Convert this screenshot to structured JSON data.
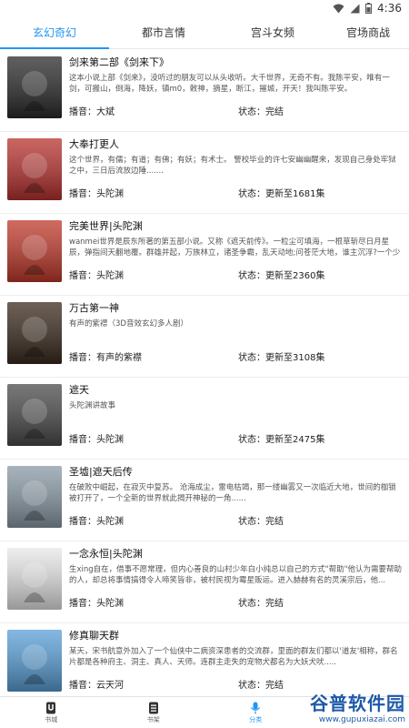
{
  "status_bar": {
    "time": "4:36"
  },
  "tabs": [
    {
      "label": "玄幻奇幻"
    },
    {
      "label": "都市言情"
    },
    {
      "label": "宫斗女频"
    },
    {
      "label": "官场商战"
    }
  ],
  "books": [
    {
      "title": "剑来第二部《剑来下》",
      "desc": "这本小说上部《剑来》，没听过的朋友可以从头收听。大千世界，无奇不有。我陈平安，唯有一剑，可搬山，倒海，降妖，镇m0，敕神，摘星，断江，摧城，开天！我叫陈平安。",
      "narrator": "播音：大斌",
      "status": "状态：完结",
      "cover_color": "#2a2a2a"
    },
    {
      "title": "大奉打更人",
      "desc": "这个世界，有儒；有道；有佛；有妖；有术士。\n警校毕业的许七安幽幽醒来，发现自己身处牢狱之中，三日后流放边陲.......",
      "narrator": "播音：头陀渊",
      "status": "状态：更新至1681集",
      "cover_color": "#b8322f"
    },
    {
      "title": "完美世界|头陀渊",
      "desc": "wanmei世界是辰东所著的第五部小说。又称《遮天前传》。一粒尘可填海，一根草斩尽日月星辰，弹指间天翻地覆。群雄并起，万族林立，诸圣争霸，乱天动地;问苍茫大地，谁主沉浮?一个少年从大荒中走出，一切从这里开始。",
      "narrator": "播音：头陀渊",
      "status": "状态：更新至2360集",
      "cover_color": "#c0392b"
    },
    {
      "title": "万古第一神",
      "desc": "有声的紫襟（3D音效玄幻多人剧）",
      "narrator": "播音：有声的紫襟",
      "status": "状态：更新至3108集",
      "cover_color": "#3a2a1e"
    },
    {
      "title": "遮天",
      "desc": "头陀渊讲故事",
      "narrator": "播音：头陀渊",
      "status": "状态：更新至2475集",
      "cover_color": "#4a4a4a"
    },
    {
      "title": "圣墟|遮天后传",
      "desc": "在破败中崛起，在寂灭中复苏。\n沧海成尘，雷电枯竭，那一缕幽雾又一次临近大地，世间的枷锁被打开了，一个全新的世界就此揭开神秘的一角......",
      "narrator": "播音：头陀渊",
      "status": "状态：完结",
      "cover_color": "#8a9aa6"
    },
    {
      "title": "一念永恒|头陀渊",
      "desc": "生xing自在，借事不愿常理，但内心善良的山村少年白小纯总以自己的方式\"帮助\"他认为需要帮助的人，却总将事情搞得令人啼笑皆非，被村民视为霉星贩运。进入赫赫有名的灵溪宗后，他...",
      "narrator": "播音：头陀渊",
      "status": "状态：完结",
      "cover_color": "#e8e8e8"
    },
    {
      "title": "修真聊天群",
      "desc": "某天，宋书航意外加入了一个仙侠中二病资深患者的交流群，里面的群友们都以'道友'相称，群名片都是各种府主、洞主、真人、天师。连群主走失的宠物犬都名为大妖犬吠.....",
      "narrator": "播音：云天河",
      "status": "状态：完结",
      "cover_color": "#5aa0d8"
    }
  ],
  "bottom_nav": [
    {
      "label": "书城"
    },
    {
      "label": "书架"
    },
    {
      "label": "分类"
    }
  ],
  "watermark": {
    "main": "谷普软件园",
    "url": "www.gupuxiazai.com"
  }
}
